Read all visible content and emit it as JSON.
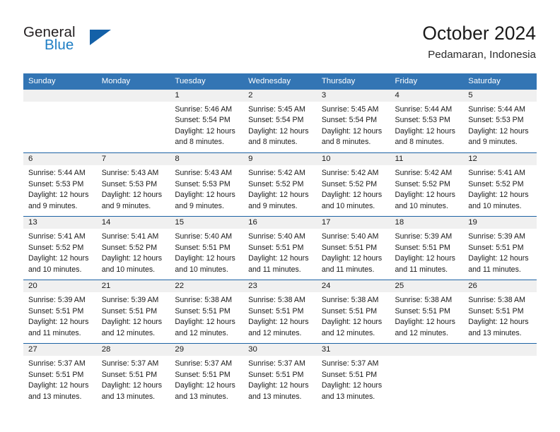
{
  "brand": {
    "name_part1": "General",
    "name_part2": "Blue",
    "logo_icon": "triangle-logo-icon"
  },
  "header": {
    "title": "October 2024",
    "subtitle": "Pedamaran, Indonesia"
  },
  "colors": {
    "header_blue": "#3375b4",
    "divider_blue": "#1d63a5",
    "day_band_gray": "#f0f0f0",
    "brand_blue": "#1f7ec4",
    "logo_blue": "#1461a8"
  },
  "calendar": {
    "weekday_headers": [
      "Sunday",
      "Monday",
      "Tuesday",
      "Wednesday",
      "Thursday",
      "Friday",
      "Saturday"
    ],
    "weeks": [
      [
        {
          "day": "",
          "empty": true,
          "sunrise": "",
          "sunset": "",
          "daylight_1": "",
          "daylight_2": ""
        },
        {
          "day": "",
          "empty": true,
          "sunrise": "",
          "sunset": "",
          "daylight_1": "",
          "daylight_2": ""
        },
        {
          "day": "1",
          "sunrise": "Sunrise: 5:46 AM",
          "sunset": "Sunset: 5:54 PM",
          "daylight_1": "Daylight: 12 hours",
          "daylight_2": "and 8 minutes."
        },
        {
          "day": "2",
          "sunrise": "Sunrise: 5:45 AM",
          "sunset": "Sunset: 5:54 PM",
          "daylight_1": "Daylight: 12 hours",
          "daylight_2": "and 8 minutes."
        },
        {
          "day": "3",
          "sunrise": "Sunrise: 5:45 AM",
          "sunset": "Sunset: 5:54 PM",
          "daylight_1": "Daylight: 12 hours",
          "daylight_2": "and 8 minutes."
        },
        {
          "day": "4",
          "sunrise": "Sunrise: 5:44 AM",
          "sunset": "Sunset: 5:53 PM",
          "daylight_1": "Daylight: 12 hours",
          "daylight_2": "and 8 minutes."
        },
        {
          "day": "5",
          "sunrise": "Sunrise: 5:44 AM",
          "sunset": "Sunset: 5:53 PM",
          "daylight_1": "Daylight: 12 hours",
          "daylight_2": "and 9 minutes."
        }
      ],
      [
        {
          "day": "6",
          "sunrise": "Sunrise: 5:44 AM",
          "sunset": "Sunset: 5:53 PM",
          "daylight_1": "Daylight: 12 hours",
          "daylight_2": "and 9 minutes."
        },
        {
          "day": "7",
          "sunrise": "Sunrise: 5:43 AM",
          "sunset": "Sunset: 5:53 PM",
          "daylight_1": "Daylight: 12 hours",
          "daylight_2": "and 9 minutes."
        },
        {
          "day": "8",
          "sunrise": "Sunrise: 5:43 AM",
          "sunset": "Sunset: 5:53 PM",
          "daylight_1": "Daylight: 12 hours",
          "daylight_2": "and 9 minutes."
        },
        {
          "day": "9",
          "sunrise": "Sunrise: 5:42 AM",
          "sunset": "Sunset: 5:52 PM",
          "daylight_1": "Daylight: 12 hours",
          "daylight_2": "and 9 minutes."
        },
        {
          "day": "10",
          "sunrise": "Sunrise: 5:42 AM",
          "sunset": "Sunset: 5:52 PM",
          "daylight_1": "Daylight: 12 hours",
          "daylight_2": "and 10 minutes."
        },
        {
          "day": "11",
          "sunrise": "Sunrise: 5:42 AM",
          "sunset": "Sunset: 5:52 PM",
          "daylight_1": "Daylight: 12 hours",
          "daylight_2": "and 10 minutes."
        },
        {
          "day": "12",
          "sunrise": "Sunrise: 5:41 AM",
          "sunset": "Sunset: 5:52 PM",
          "daylight_1": "Daylight: 12 hours",
          "daylight_2": "and 10 minutes."
        }
      ],
      [
        {
          "day": "13",
          "sunrise": "Sunrise: 5:41 AM",
          "sunset": "Sunset: 5:52 PM",
          "daylight_1": "Daylight: 12 hours",
          "daylight_2": "and 10 minutes."
        },
        {
          "day": "14",
          "sunrise": "Sunrise: 5:41 AM",
          "sunset": "Sunset: 5:52 PM",
          "daylight_1": "Daylight: 12 hours",
          "daylight_2": "and 10 minutes."
        },
        {
          "day": "15",
          "sunrise": "Sunrise: 5:40 AM",
          "sunset": "Sunset: 5:51 PM",
          "daylight_1": "Daylight: 12 hours",
          "daylight_2": "and 10 minutes."
        },
        {
          "day": "16",
          "sunrise": "Sunrise: 5:40 AM",
          "sunset": "Sunset: 5:51 PM",
          "daylight_1": "Daylight: 12 hours",
          "daylight_2": "and 11 minutes."
        },
        {
          "day": "17",
          "sunrise": "Sunrise: 5:40 AM",
          "sunset": "Sunset: 5:51 PM",
          "daylight_1": "Daylight: 12 hours",
          "daylight_2": "and 11 minutes."
        },
        {
          "day": "18",
          "sunrise": "Sunrise: 5:39 AM",
          "sunset": "Sunset: 5:51 PM",
          "daylight_1": "Daylight: 12 hours",
          "daylight_2": "and 11 minutes."
        },
        {
          "day": "19",
          "sunrise": "Sunrise: 5:39 AM",
          "sunset": "Sunset: 5:51 PM",
          "daylight_1": "Daylight: 12 hours",
          "daylight_2": "and 11 minutes."
        }
      ],
      [
        {
          "day": "20",
          "sunrise": "Sunrise: 5:39 AM",
          "sunset": "Sunset: 5:51 PM",
          "daylight_1": "Daylight: 12 hours",
          "daylight_2": "and 11 minutes."
        },
        {
          "day": "21",
          "sunrise": "Sunrise: 5:39 AM",
          "sunset": "Sunset: 5:51 PM",
          "daylight_1": "Daylight: 12 hours",
          "daylight_2": "and 12 minutes."
        },
        {
          "day": "22",
          "sunrise": "Sunrise: 5:38 AM",
          "sunset": "Sunset: 5:51 PM",
          "daylight_1": "Daylight: 12 hours",
          "daylight_2": "and 12 minutes."
        },
        {
          "day": "23",
          "sunrise": "Sunrise: 5:38 AM",
          "sunset": "Sunset: 5:51 PM",
          "daylight_1": "Daylight: 12 hours",
          "daylight_2": "and 12 minutes."
        },
        {
          "day": "24",
          "sunrise": "Sunrise: 5:38 AM",
          "sunset": "Sunset: 5:51 PM",
          "daylight_1": "Daylight: 12 hours",
          "daylight_2": "and 12 minutes."
        },
        {
          "day": "25",
          "sunrise": "Sunrise: 5:38 AM",
          "sunset": "Sunset: 5:51 PM",
          "daylight_1": "Daylight: 12 hours",
          "daylight_2": "and 12 minutes."
        },
        {
          "day": "26",
          "sunrise": "Sunrise: 5:38 AM",
          "sunset": "Sunset: 5:51 PM",
          "daylight_1": "Daylight: 12 hours",
          "daylight_2": "and 13 minutes."
        }
      ],
      [
        {
          "day": "27",
          "sunrise": "Sunrise: 5:37 AM",
          "sunset": "Sunset: 5:51 PM",
          "daylight_1": "Daylight: 12 hours",
          "daylight_2": "and 13 minutes."
        },
        {
          "day": "28",
          "sunrise": "Sunrise: 5:37 AM",
          "sunset": "Sunset: 5:51 PM",
          "daylight_1": "Daylight: 12 hours",
          "daylight_2": "and 13 minutes."
        },
        {
          "day": "29",
          "sunrise": "Sunrise: 5:37 AM",
          "sunset": "Sunset: 5:51 PM",
          "daylight_1": "Daylight: 12 hours",
          "daylight_2": "and 13 minutes."
        },
        {
          "day": "30",
          "sunrise": "Sunrise: 5:37 AM",
          "sunset": "Sunset: 5:51 PM",
          "daylight_1": "Daylight: 12 hours",
          "daylight_2": "and 13 minutes."
        },
        {
          "day": "31",
          "sunrise": "Sunrise: 5:37 AM",
          "sunset": "Sunset: 5:51 PM",
          "daylight_1": "Daylight: 12 hours",
          "daylight_2": "and 13 minutes."
        },
        {
          "day": "",
          "empty": true,
          "sunrise": "",
          "sunset": "",
          "daylight_1": "",
          "daylight_2": ""
        },
        {
          "day": "",
          "empty": true,
          "sunrise": "",
          "sunset": "",
          "daylight_1": "",
          "daylight_2": ""
        }
      ]
    ]
  }
}
